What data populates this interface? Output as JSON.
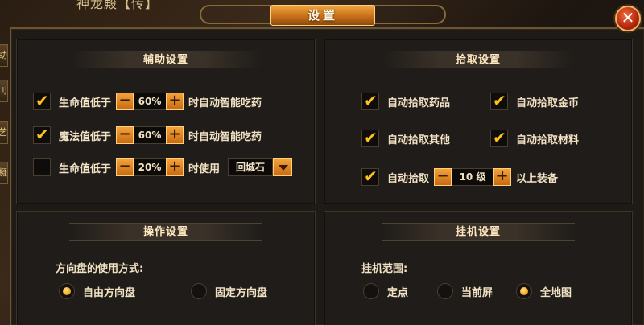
{
  "background": {
    "top_text": "神龙殿【传】",
    "side_tabs": [
      "助",
      "刂",
      "艺",
      "擬"
    ]
  },
  "window": {
    "title": "设置",
    "close_glyph": "✕"
  },
  "assist": {
    "title": "辅助设置",
    "rows": [
      {
        "checked": true,
        "label": "生命值低于",
        "value": "60%",
        "suffix": "时自动智能吃药"
      },
      {
        "checked": true,
        "label": "魔法值低于",
        "value": "60%",
        "suffix": "时自动智能吃药"
      },
      {
        "checked": false,
        "label": "生命值低于",
        "value": "20%",
        "suffix": "时使用",
        "select_value": "回城石"
      }
    ]
  },
  "pickup": {
    "title": "拾取设置",
    "items": [
      {
        "checked": true,
        "label": "自动拾取药品"
      },
      {
        "checked": true,
        "label": "自动拾取金币"
      },
      {
        "checked": true,
        "label": "自动拾取其他"
      },
      {
        "checked": true,
        "label": "自动拾取材料"
      }
    ],
    "level_row": {
      "checked": true,
      "label": "自动拾取",
      "value": "10 级",
      "suffix": "以上装备"
    }
  },
  "operation": {
    "title": "操作设置",
    "question": "方向盘的使用方式:",
    "options": [
      {
        "label": "自由方向盘",
        "selected": true
      },
      {
        "label": "固定方向盘",
        "selected": false
      }
    ]
  },
  "idle": {
    "title": "挂机设置",
    "question": "挂机范围:",
    "options": [
      {
        "label": "定点",
        "selected": false
      },
      {
        "label": "当前屏",
        "selected": false
      },
      {
        "label": "全地图",
        "selected": true
      }
    ]
  },
  "glyphs": {
    "check": "✔",
    "minus": "−",
    "plus": "+"
  },
  "colors": {
    "accent": "#f0a53d",
    "check": "#ffc21a",
    "text": "#f2e2c4"
  }
}
